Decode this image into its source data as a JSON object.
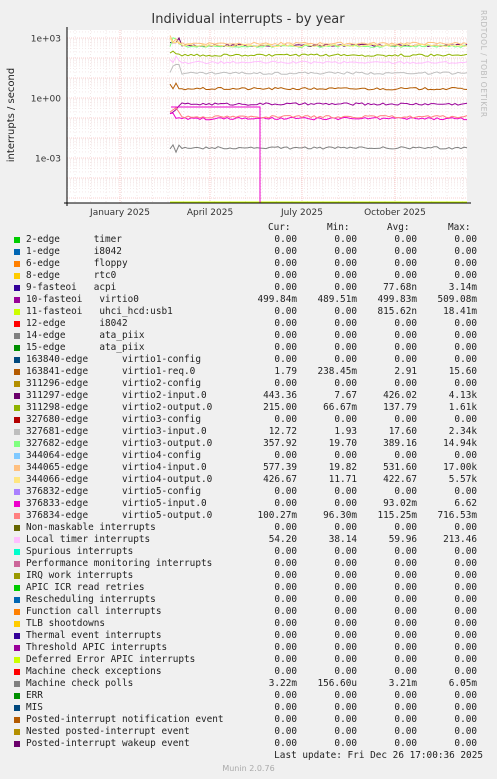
{
  "chart_data": {
    "type": "line",
    "title": "Individual interrupts - by year",
    "ylabel": "interrupts / second",
    "yscale": "log",
    "y_ticks": [
      "1e+03",
      "1e+00",
      "1e-03"
    ],
    "x_ticks": [
      "January 2025",
      "April 2025",
      "July 2025",
      "October 2025"
    ],
    "columns": [
      "Cur:",
      "Min:",
      "Avg:",
      "Max:"
    ],
    "series": [
      {
        "name": "2-edge      timer",
        "color": "#00cc00",
        "cur": "0.00",
        "min": "0.00",
        "avg": "0.00",
        "max": "0.00"
      },
      {
        "name": "1-edge      i8042",
        "color": "#0066b3",
        "cur": "0.00",
        "min": "0.00",
        "avg": "0.00",
        "max": "0.00"
      },
      {
        "name": "6-edge      floppy",
        "color": "#ff8000",
        "cur": "0.00",
        "min": "0.00",
        "avg": "0.00",
        "max": "0.00"
      },
      {
        "name": "8-edge      rtc0",
        "color": "#ffcc00",
        "cur": "0.00",
        "min": "0.00",
        "avg": "0.00",
        "max": "0.00"
      },
      {
        "name": "9-fasteoi   acpi",
        "color": "#330099",
        "cur": "0.00",
        "min": "0.00",
        "avg": "77.68n",
        "max": "3.14m"
      },
      {
        "name": "10-fasteoi   virtio0",
        "color": "#990099",
        "cur": "499.84m",
        "min": "489.51m",
        "avg": "499.83m",
        "max": "509.08m"
      },
      {
        "name": "11-fasteoi   uhci_hcd:usb1",
        "color": "#ccff00",
        "cur": "0.00",
        "min": "0.00",
        "avg": "815.62n",
        "max": "18.41m"
      },
      {
        "name": "12-edge      i8042",
        "color": "#ff0000",
        "cur": "0.00",
        "min": "0.00",
        "avg": "0.00",
        "max": "0.00"
      },
      {
        "name": "14-edge      ata_piix",
        "color": "#808080",
        "cur": "0.00",
        "min": "0.00",
        "avg": "0.00",
        "max": "0.00"
      },
      {
        "name": "15-edge      ata_piix",
        "color": "#008f00",
        "cur": "0.00",
        "min": "0.00",
        "avg": "0.00",
        "max": "0.00"
      },
      {
        "name": "163840-edge      virtio1-config",
        "color": "#00487d",
        "cur": "0.00",
        "min": "0.00",
        "avg": "0.00",
        "max": "0.00"
      },
      {
        "name": "163841-edge      virtio1-req.0",
        "color": "#b35a00",
        "cur": "1.79",
        "min": "238.45m",
        "avg": "2.91",
        "max": "15.60"
      },
      {
        "name": "311296-edge      virtio2-config",
        "color": "#b38f00",
        "cur": "0.00",
        "min": "0.00",
        "avg": "0.00",
        "max": "0.00"
      },
      {
        "name": "311297-edge      virtio2-input.0",
        "color": "#6b006b",
        "cur": "443.36",
        "min": "7.67",
        "avg": "426.02",
        "max": "4.13k"
      },
      {
        "name": "311298-edge      virtio2-output.0",
        "color": "#8fb300",
        "cur": "215.00",
        "min": "66.67m",
        "avg": "137.79",
        "max": "1.61k"
      },
      {
        "name": "327680-edge      virtio3-config",
        "color": "#b30000",
        "cur": "0.00",
        "min": "0.00",
        "avg": "0.00",
        "max": "0.00"
      },
      {
        "name": "327681-edge      virtio3-input.0",
        "color": "#bebebe",
        "cur": "12.72",
        "min": "1.93",
        "avg": "17.60",
        "max": "2.34k"
      },
      {
        "name": "327682-edge      virtio3-output.0",
        "color": "#80ff80",
        "cur": "357.92",
        "min": "19.70",
        "avg": "389.16",
        "max": "14.94k"
      },
      {
        "name": "344064-edge      virtio4-config",
        "color": "#80c9ff",
        "cur": "0.00",
        "min": "0.00",
        "avg": "0.00",
        "max": "0.00"
      },
      {
        "name": "344065-edge      virtio4-input.0",
        "color": "#ffc080",
        "cur": "577.39",
        "min": "19.82",
        "avg": "531.60",
        "max": "17.00k"
      },
      {
        "name": "344066-edge      virtio4-output.0",
        "color": "#ffe680",
        "cur": "426.67",
        "min": "11.71",
        "avg": "422.67",
        "max": "5.57k"
      },
      {
        "name": "376832-edge      virtio5-config",
        "color": "#aa80ff",
        "cur": "0.00",
        "min": "0.00",
        "avg": "0.00",
        "max": "0.00"
      },
      {
        "name": "376833-edge      virtio5-input.0",
        "color": "#ee00cc",
        "cur": "0.00",
        "min": "0.00",
        "avg": "93.02m",
        "max": "6.62"
      },
      {
        "name": "376834-edge      virtio5-output.0",
        "color": "#ff8080",
        "cur": "100.27m",
        "min": "96.30m",
        "avg": "115.25m",
        "max": "716.53m"
      },
      {
        "name": "Non-maskable interrupts",
        "color": "#666600",
        "cur": "0.00",
        "min": "0.00",
        "avg": "0.00",
        "max": "0.00"
      },
      {
        "name": "Local timer interrupts",
        "color": "#ffbfff",
        "cur": "54.20",
        "min": "38.14",
        "avg": "59.96",
        "max": "213.46"
      },
      {
        "name": "Spurious interrupts",
        "color": "#00ffcc",
        "cur": "0.00",
        "min": "0.00",
        "avg": "0.00",
        "max": "0.00"
      },
      {
        "name": "Performance monitoring interrupts",
        "color": "#cc6699",
        "cur": "0.00",
        "min": "0.00",
        "avg": "0.00",
        "max": "0.00"
      },
      {
        "name": "IRQ work interrupts",
        "color": "#999900",
        "cur": "0.00",
        "min": "0.00",
        "avg": "0.00",
        "max": "0.00"
      },
      {
        "name": "APIC ICR read retries",
        "color": "#00cc00",
        "cur": "0.00",
        "min": "0.00",
        "avg": "0.00",
        "max": "0.00"
      },
      {
        "name": "Rescheduling interrupts",
        "color": "#0066b3",
        "cur": "0.00",
        "min": "0.00",
        "avg": "0.00",
        "max": "0.00"
      },
      {
        "name": "Function call interrupts",
        "color": "#ff8000",
        "cur": "0.00",
        "min": "0.00",
        "avg": "0.00",
        "max": "0.00"
      },
      {
        "name": "TLB shootdowns",
        "color": "#ffcc00",
        "cur": "0.00",
        "min": "0.00",
        "avg": "0.00",
        "max": "0.00"
      },
      {
        "name": "Thermal event interrupts",
        "color": "#330099",
        "cur": "0.00",
        "min": "0.00",
        "avg": "0.00",
        "max": "0.00"
      },
      {
        "name": "Threshold APIC interrupts",
        "color": "#990099",
        "cur": "0.00",
        "min": "0.00",
        "avg": "0.00",
        "max": "0.00"
      },
      {
        "name": "Deferred Error APIC interrupts",
        "color": "#ccff00",
        "cur": "0.00",
        "min": "0.00",
        "avg": "0.00",
        "max": "0.00"
      },
      {
        "name": "Machine check exceptions",
        "color": "#ff0000",
        "cur": "0.00",
        "min": "0.00",
        "avg": "0.00",
        "max": "0.00"
      },
      {
        "name": "Machine check polls",
        "color": "#808080",
        "cur": "3.22m",
        "min": "156.60u",
        "avg": "3.21m",
        "max": "6.05m"
      },
      {
        "name": "ERR",
        "color": "#008f00",
        "cur": "0.00",
        "min": "0.00",
        "avg": "0.00",
        "max": "0.00"
      },
      {
        "name": "MIS",
        "color": "#00487d",
        "cur": "0.00",
        "min": "0.00",
        "avg": "0.00",
        "max": "0.00"
      },
      {
        "name": "Posted-interrupt notification event",
        "color": "#b35a00",
        "cur": "0.00",
        "min": "0.00",
        "avg": "0.00",
        "max": "0.00"
      },
      {
        "name": "Nested posted-interrupt event",
        "color": "#b38f00",
        "cur": "0.00",
        "min": "0.00",
        "avg": "0.00",
        "max": "0.00"
      },
      {
        "name": "Posted-interrupt wakeup event",
        "color": "#6b006b",
        "cur": "0.00",
        "min": "0.00",
        "avg": "0.00",
        "max": "0.00"
      }
    ]
  },
  "last_update": "Last update: Fri Dec 26 17:00:36 2025",
  "footer": "Munin 2.0.76",
  "watermark": "RRDTOOL / TOBI OETIKER"
}
